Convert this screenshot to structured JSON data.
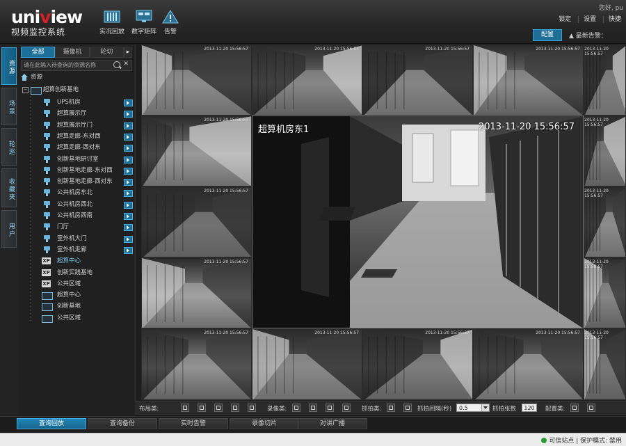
{
  "app": {
    "logo_main": "uniview",
    "logo_sub": "视频监控系统",
    "user": "您好, pu",
    "brand_red": "#d61f26",
    "accent": "#1b6f98"
  },
  "topnav": [
    {
      "label": "实况回放",
      "icon": "live-playback-icon"
    },
    {
      "label": "数字矩阵",
      "icon": "matrix-icon"
    },
    {
      "label": "告警",
      "icon": "alarm-icon"
    }
  ],
  "top_links": [
    "锁定",
    "设置",
    "快捷"
  ],
  "config_button": "配置",
  "alarm_count": "▲ 最新告警：",
  "vtabs": [
    "资源",
    "场景",
    "轮巡",
    "收藏夹",
    "用户"
  ],
  "panel_tabs": [
    "全部",
    "摄像机",
    "轮切"
  ],
  "search": {
    "placeholder": "请在此输入待查询的资源名称"
  },
  "tree": {
    "root": "资源",
    "org": "超算创新基地",
    "cameras": [
      "UPS机房",
      "超算展示厅",
      "超算展示厅门",
      "超算走廊-东对西",
      "超算走廊-西对东",
      "创新基地研讨室",
      "创新基地走廊-东对西",
      "创新基地走廊-西对东",
      "公共机房东北",
      "公共机房西北",
      "公共机房西南",
      "门厅",
      "室外机大门",
      "室外机走廊"
    ],
    "xp_groups": [
      "超算中心",
      "创新实践基地",
      "公共区域"
    ],
    "folders": [
      "超算中心",
      "创新基地",
      "公共区域"
    ]
  },
  "video": {
    "main_title": "超算机房东1",
    "main_time": "2013-11-20  15:56:57",
    "osd": "2013-11-20 15:56:57"
  },
  "toolbar": {
    "layout_label": "布局类:",
    "record_label": "录像类:",
    "capture_label": "抓拍类:",
    "interval_label": "抓拍间隔(秒)",
    "interval_value": "0.5",
    "count_label": "抓拍张数",
    "count_value": "120",
    "config_label": "配置类:"
  },
  "bottom_tabs": [
    "查询回放",
    "查询备份",
    "实时告警",
    "录像切片",
    "对讲广播"
  ],
  "status": {
    "site": "可信站点",
    "protected": "保护模式: 禁用"
  }
}
